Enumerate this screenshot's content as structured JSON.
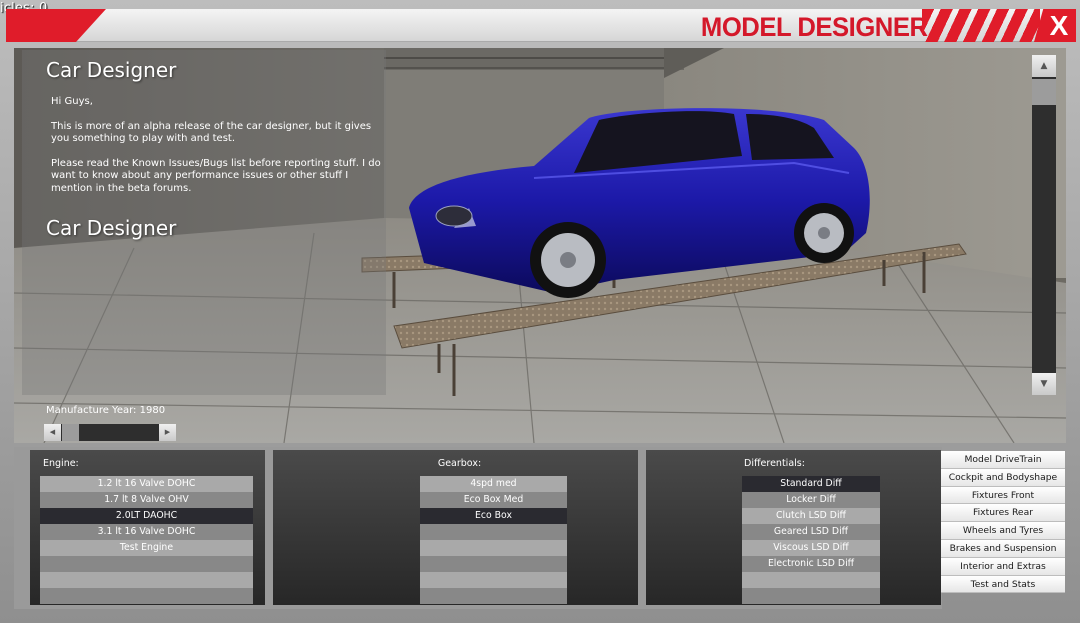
{
  "hud": {
    "vehicles_count": "icles: 0"
  },
  "header": {
    "title": "MODEL DESIGNER",
    "close_label": "X"
  },
  "info": {
    "heading": "Car Designer",
    "greeting": "Hi Guys,",
    "paragraph1": "This is more of an alpha release of the car designer, but it gives you something to play with and test.",
    "paragraph2": "Please read the Known Issues/Bugs list before reporting stuff. I do want to know about any performance issues or other stuff I mention in the beta forums.",
    "heading2": "Car Designer"
  },
  "manufacture": {
    "label": "Manufacture Year: 1980"
  },
  "engine": {
    "label": "Engine:",
    "options": [
      "1.2 lt 16 Valve  DOHC",
      "1.7 lt 8 Valve  OHV",
      "2.0LT DAOHC",
      "3.1 lt 16 Valve  DOHC",
      "Test Engine",
      "",
      "",
      ""
    ],
    "selected_index": 2
  },
  "gearbox": {
    "label": "Gearbox:",
    "options": [
      "4spd med",
      "Eco Box Med",
      "Eco Box",
      "",
      "",
      "",
      "",
      ""
    ],
    "selected_index": 2
  },
  "differentials": {
    "label": "Differentials:",
    "options": [
      "Standard Diff",
      "Locker Diff",
      "Clutch LSD Diff",
      "Geared LSD Diff",
      "Viscous LSD Diff",
      "Electronic LSD Diff",
      "",
      ""
    ],
    "selected_index": 0
  },
  "side_menu": {
    "items": [
      "Model DriveTrain",
      "Cockpit and Bodyshape",
      "Fixtures Front",
      "Fixtures Rear",
      "Wheels and Tyres",
      "Brakes and Suspension",
      "Interior and Extras",
      "Test and Stats"
    ]
  },
  "colors": {
    "accent_red": "#e01c2a",
    "car_body": "#1a17a8",
    "panel_dark": "#2e2e2e"
  }
}
